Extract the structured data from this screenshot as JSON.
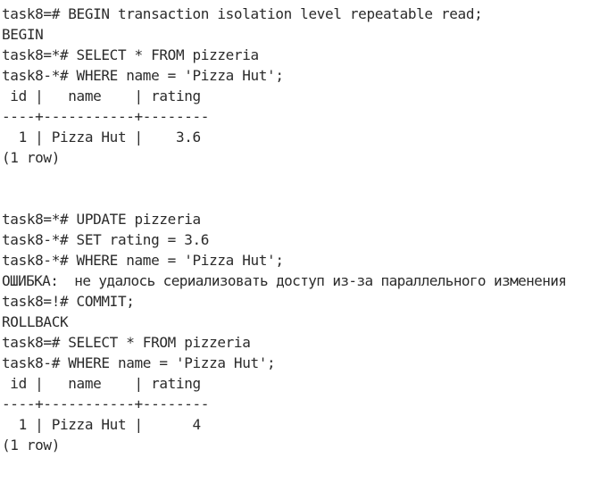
{
  "terminal": {
    "lines": [
      "task8=# BEGIN transaction isolation level repeatable read;",
      "BEGIN",
      "task8=*# SELECT * FROM pizzeria",
      "task8-*# WHERE name = 'Pizza Hut';",
      " id |   name    | rating",
      "----+-----------+--------",
      "  1 | Pizza Hut |    3.6",
      "(1 row)",
      "",
      "",
      "task8=*# UPDATE pizzeria",
      "task8-*# SET rating = 3.6",
      "task8-*# WHERE name = 'Pizza Hut';",
      "ОШИБКА:  не удалось сериализовать доступ из-за параллельного изменения",
      "task8=!# COMMIT;",
      "ROLLBACK",
      "task8=# SELECT * FROM pizzeria",
      "task8-# WHERE name = 'Pizza Hut';",
      " id |   name    | rating",
      "----+-----------+--------",
      "  1 | Pizza Hut |      4",
      "(1 row)"
    ]
  }
}
